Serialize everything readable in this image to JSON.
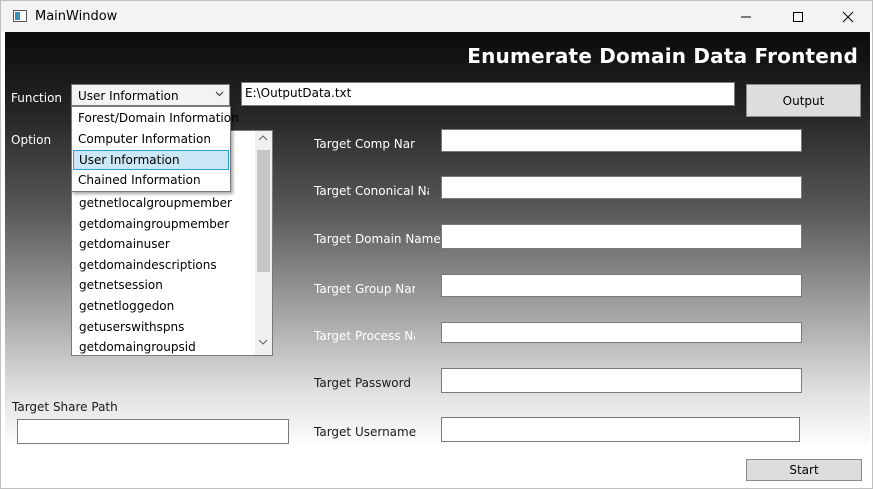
{
  "window": {
    "title": "MainWindow"
  },
  "header": {
    "title": "Enumerate Domain Data Frontend"
  },
  "function_label": "Function",
  "function_combo": {
    "selected": "User Information",
    "options": [
      "Forest/Domain Information",
      "Computer Information",
      "User Information",
      "Chained Information"
    ]
  },
  "output_path": "E:\\OutputData.txt",
  "output_button": "Output",
  "option_label": "Option",
  "option_list": [
    "getnetlocalgroupmember",
    "getdomaingroupmember",
    "getdomainuser",
    "getdomaindescriptions",
    "getnetsession",
    "getnetloggedon",
    "getuserswithspns",
    "getdomaingroupsid"
  ],
  "fields": {
    "comp_name": "Target Comp Name",
    "cononical_name": "Target Cononical Nam",
    "domain_name": "Target Domain Name",
    "group_name": "Target Group Name",
    "process_name": "Target Process Nam",
    "password": "Target Password",
    "username": "Target Username",
    "share_path": "Target Share Path"
  },
  "start_button": "Start",
  "colors": {
    "header_text": "#ffffff",
    "selection_bg": "#cce8f6",
    "selection_border": "#26a0da"
  }
}
